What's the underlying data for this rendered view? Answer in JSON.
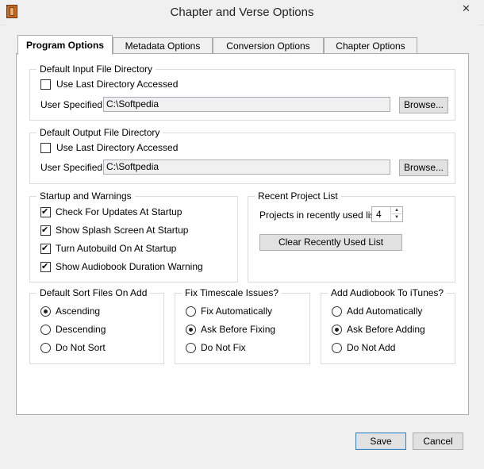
{
  "window": {
    "title": "Chapter and Verse Options",
    "close_glyph": "✕",
    "icon": "app-book-icon"
  },
  "tabs": [
    {
      "label": "Program Options",
      "active": true
    },
    {
      "label": "Metadata Options",
      "active": false
    },
    {
      "label": "Conversion Options",
      "active": false
    },
    {
      "label": "Chapter Options",
      "active": false
    }
  ],
  "input_dir": {
    "legend": "Default Input File Directory",
    "use_last_label": "Use Last Directory Accessed",
    "use_last_checked": false,
    "user_specified_label": "User Specified:",
    "path_value": "C:\\Softpedia",
    "browse_label": "Browse..."
  },
  "output_dir": {
    "legend": "Default Output File Directory",
    "use_last_label": "Use Last Directory Accessed",
    "use_last_checked": false,
    "user_specified_label": "User Specified:",
    "path_value": "C:\\Softpedia",
    "browse_label": "Browse..."
  },
  "startup": {
    "legend": "Startup and Warnings",
    "items": [
      {
        "label": "Check For Updates At Startup",
        "checked": true
      },
      {
        "label": "Show Splash Screen At Startup",
        "checked": true
      },
      {
        "label": "Turn Autobuild On At Startup",
        "checked": true
      },
      {
        "label": "Show Audiobook Duration Warning",
        "checked": true
      }
    ]
  },
  "recent": {
    "legend": "Recent Project List",
    "projects_label": "Projects in recently used list:",
    "projects_value": "4",
    "clear_label": "Clear Recently Used List"
  },
  "sort": {
    "legend": "Default Sort Files On Add",
    "options": [
      {
        "label": "Ascending",
        "selected": true
      },
      {
        "label": "Descending",
        "selected": false
      },
      {
        "label": "Do Not Sort",
        "selected": false
      }
    ]
  },
  "timescale": {
    "legend": "Fix Timescale Issues?",
    "options": [
      {
        "label": "Fix Automatically",
        "selected": false
      },
      {
        "label": "Ask Before Fixing",
        "selected": true
      },
      {
        "label": "Do Not Fix",
        "selected": false
      }
    ]
  },
  "itunes": {
    "legend": "Add Audiobook To iTunes?",
    "options": [
      {
        "label": "Add Automatically",
        "selected": false
      },
      {
        "label": "Ask Before Adding",
        "selected": true
      },
      {
        "label": "Do Not Add",
        "selected": false
      }
    ]
  },
  "footer": {
    "save_label": "Save",
    "cancel_label": "Cancel"
  }
}
